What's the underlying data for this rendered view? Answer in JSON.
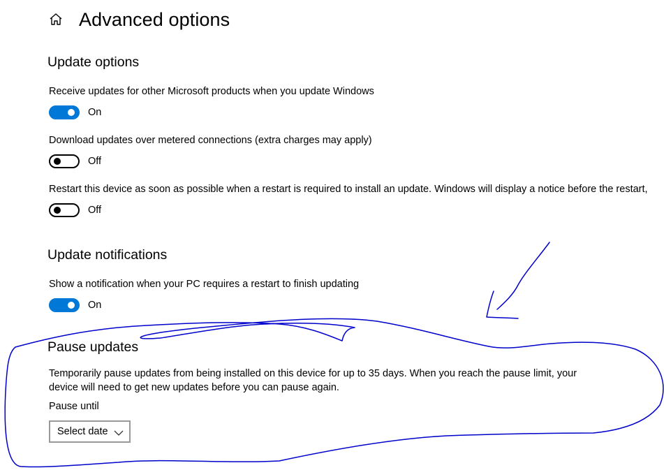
{
  "header": {
    "title": "Advanced options",
    "home_icon": "home-icon"
  },
  "update_options": {
    "title": "Update options",
    "settings": [
      {
        "label": "Receive updates for other Microsoft products when you update Windows",
        "state": "On",
        "enabled": true
      },
      {
        "label": "Download updates over metered connections (extra charges may apply)",
        "state": "Off",
        "enabled": false
      },
      {
        "label": "Restart this device as soon as possible when a restart is required to install an update. Windows will display a notice before the restart,",
        "state": "Off",
        "enabled": false
      }
    ]
  },
  "update_notifications": {
    "title": "Update notifications",
    "settings": [
      {
        "label": "Show a notification when your PC requires a restart to finish updating",
        "state": "On",
        "enabled": true
      }
    ]
  },
  "pause_updates": {
    "title": "Pause updates",
    "description": "Temporarily pause updates from being installed on this device for up to 35 days. When you reach the pause limit, your device will need to get new updates before you can pause again.",
    "pause_until_label": "Pause until",
    "select_value": "Select date",
    "chevron_icon": "chevron-down-icon"
  },
  "colors": {
    "accent": "#0078d7",
    "annotation_ink": "#0000cc",
    "select_border": "#999999"
  }
}
